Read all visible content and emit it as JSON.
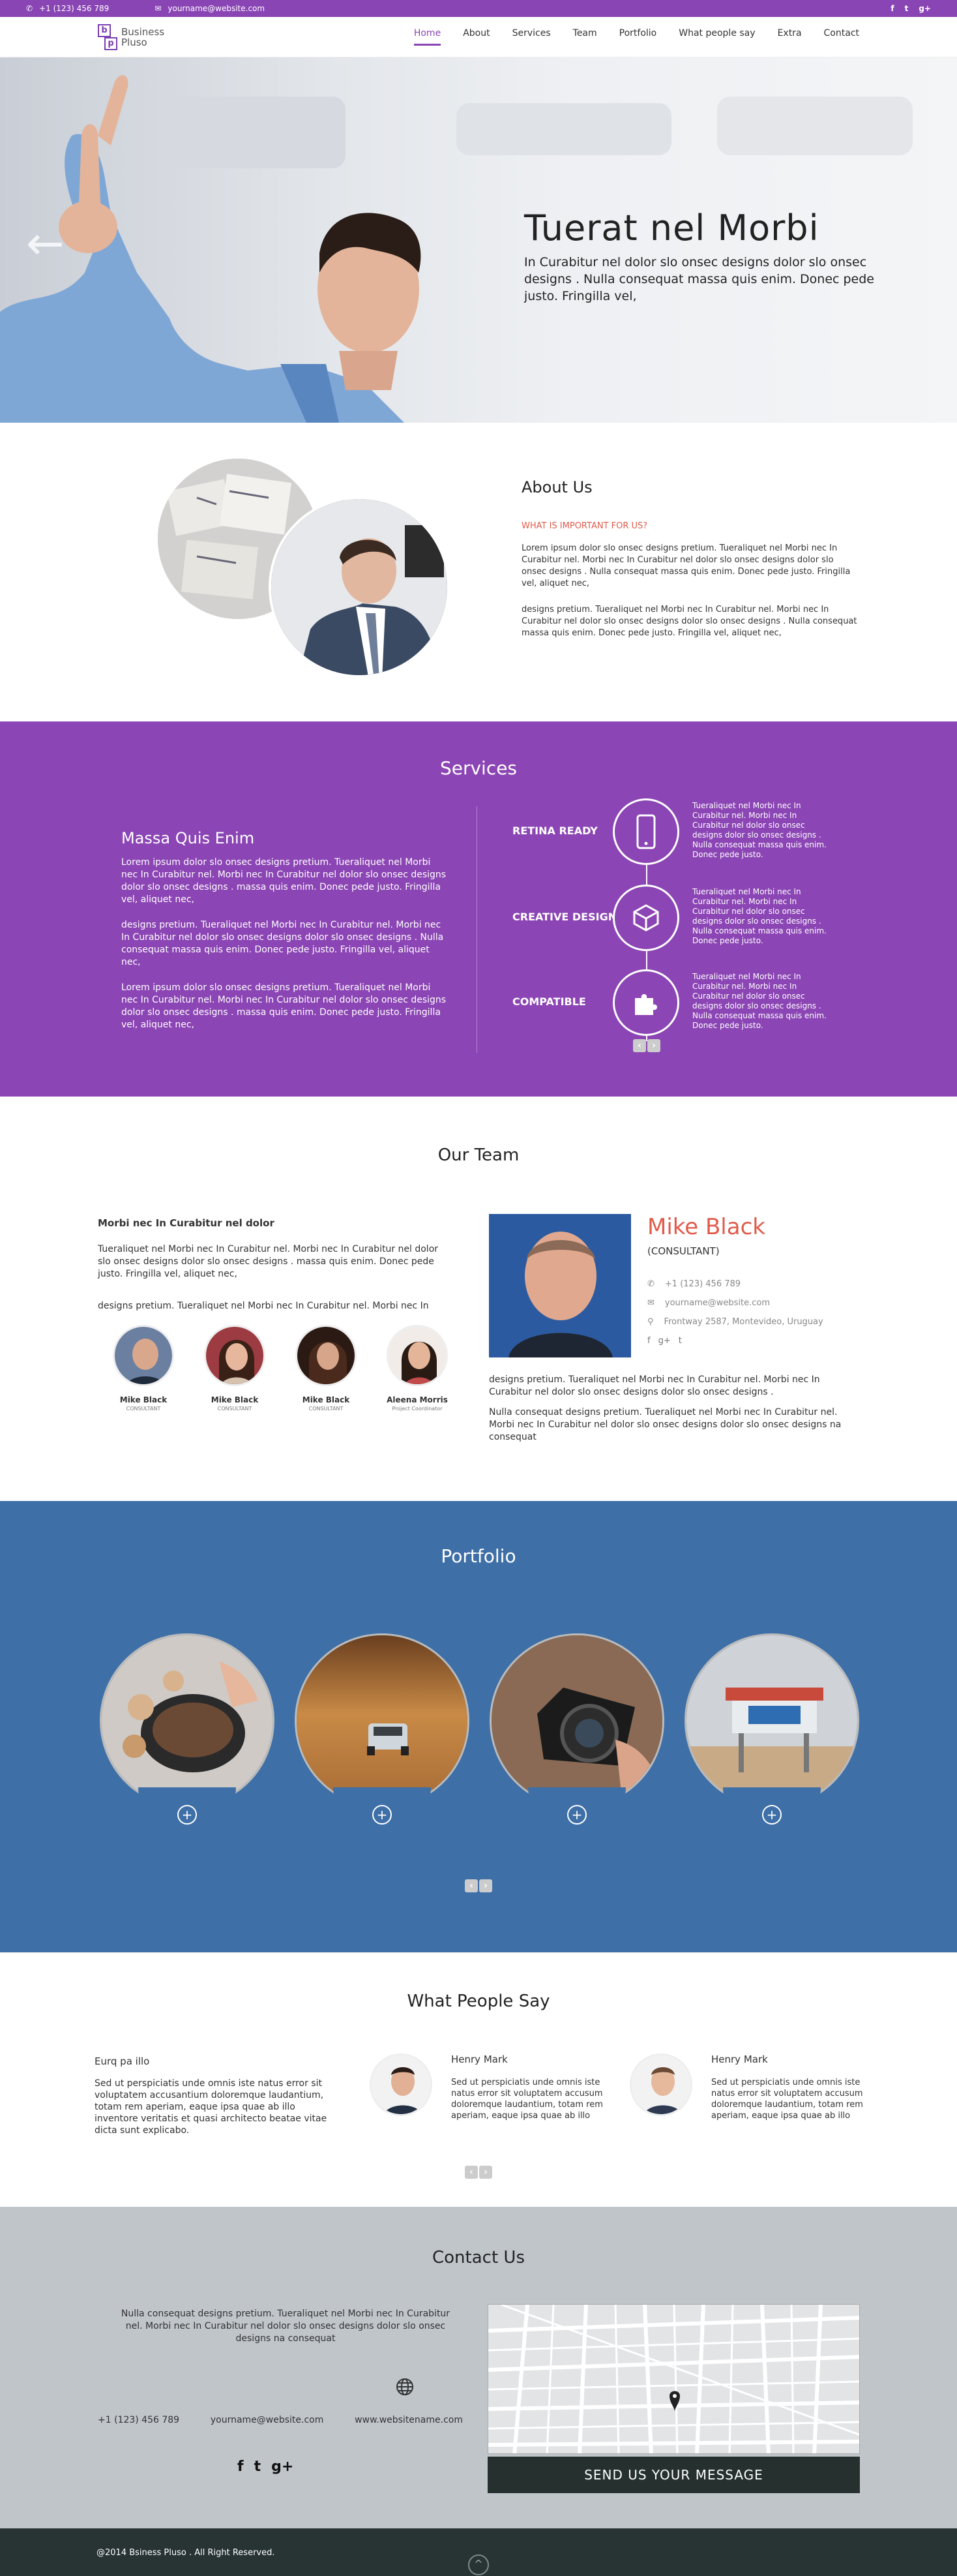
{
  "topbar": {
    "phone": "+1 (123) 456 789",
    "email": "yourname@website.com",
    "social": [
      "f",
      "t",
      "g+"
    ]
  },
  "logo": {
    "b": "b",
    "p": "p",
    "line1": "Business",
    "line2": "Pluso"
  },
  "nav": [
    "Home",
    "About",
    "Services",
    "Team",
    "Portfolio",
    "What people say",
    "Extra",
    "Contact"
  ],
  "hero": {
    "title": "Tuerat nel Morbi",
    "text": "In Curabitur nel dolor slo onsec designs dolor slo onsec designs . Nulla consequat massa quis enim. Donec pede justo. Fringilla vel,",
    "arrow": "←"
  },
  "about": {
    "title": "About Us",
    "subtitle": "WHAT IS IMPORTANT FOR US?",
    "p1": "Lorem ipsum dolor slo onsec designs pretium. Tueraliquet nel Morbi nec In Curabitur nel. Morbi nec In Curabitur nel dolor slo onsec designs dolor slo onsec designs . Nulla consequat massa quis enim. Donec pede justo. Fringilla vel, aliquet nec,",
    "p2": "designs pretium. Tueraliquet nel Morbi nec In Curabitur nel. Morbi nec In Curabitur nel dolor slo onsec designs dolor slo onsec designs . Nulla consequat massa quis enim. Donec pede justo. Fringilla vel, aliquet nec,"
  },
  "services": {
    "title": "Services",
    "left_title": "Massa Quis Enim",
    "left_p1": "Lorem ipsum dolor slo onsec designs pretium. Tueraliquet nel Morbi nec In Curabitur nel. Morbi nec In Curabitur nel dolor slo onsec designs dolor slo onsec designs .    massa quis enim. Donec pede justo. Fringilla vel, aliquet nec,",
    "left_p2": "designs pretium. Tueraliquet nel Morbi nec In Curabitur nel. Morbi nec In Curabitur nel dolor slo onsec designs dolor slo onsec designs . Nulla consequat massa quis enim. Donec pede justo. Fringilla vel, aliquet nec,",
    "left_p3": "Lorem ipsum dolor slo onsec designs pretium. Tueraliquet nel Morbi nec In Curabitur nel. Morbi nec In Curabitur nel dolor slo onsec designs dolor slo onsec designs .    massa quis enim. Donec pede justo. Fringilla vel, aliquet nec,",
    "items": [
      {
        "label": "RETINA READY",
        "icon": "phone-icon",
        "glyph": "▯",
        "desc": "Tueraliquet nel Morbi nec In Curabitur nel. Morbi nec In Curabitur nel dolor slo onsec designs dolor slo onsec designs . Nulla consequat massa quis enim. Donec pede justo."
      },
      {
        "label": "CREATIVE DESIGN",
        "icon": "cube-icon",
        "glyph": "⬡",
        "desc": "Tueraliquet nel Morbi nec In Curabitur nel. Morbi nec In Curabitur nel dolor slo onsec designs dolor slo onsec designs . Nulla consequat massa quis enim. Donec pede justo."
      },
      {
        "label": "COMPATIBLE",
        "icon": "puzzle-icon",
        "glyph": "✚",
        "desc": "Tueraliquet nel Morbi nec In Curabitur nel. Morbi nec In Curabitur nel dolor slo onsec designs dolor slo onsec designs . Nulla consequat massa quis enim. Donec pede justo."
      }
    ],
    "prev": "‹",
    "next": "›"
  },
  "team": {
    "title": "Our Team",
    "left_title": "Morbi nec In Curabitur nel dolor",
    "left_p1": "Tueraliquet nel Morbi nec In Curabitur nel. Morbi nec In Curabitur nel dolor slo onsec designs dolor slo onsec designs .    massa quis enim. Donec pede justo. Fringilla vel, aliquet nec,",
    "left_p2": "designs pretium. Tueraliquet nel Morbi nec In Curabitur nel. Morbi nec In",
    "members": [
      {
        "name": "Mike Black",
        "role": "CONSULTANT"
      },
      {
        "name": "Mike Black",
        "role": "CONSULTANT"
      },
      {
        "name": "Mike Black",
        "role": "CONSULTANT"
      },
      {
        "name": "Aleena Morris",
        "role": "Project Coordinator"
      }
    ],
    "profile": {
      "name": "Mike Black",
      "role": "(CONSULTANT)",
      "phone": "+1 (123) 456 789",
      "email": "yourname@website.com",
      "address": "Frontway 2587, Montevideo, Uruguay",
      "social": [
        "f",
        "g+",
        "t"
      ]
    },
    "bottom_p1": "designs pretium. Tueraliquet nel Morbi nec In Curabitur nel. Morbi nec In Curabitur nel dolor slo onsec designs dolor slo onsec designs .",
    "bottom_p2": "Nulla consequat designs pretium. Tueraliquet nel Morbi nec In Curabitur nel. Morbi nec In Curabitur nel dolor slo onsec designs dolor slo onsec designs na consequat"
  },
  "portfolio": {
    "title": "Portfolio",
    "plus": "+",
    "prev": "‹",
    "next": "›"
  },
  "testimonials": {
    "title": "What People Say",
    "first_title": "Eurq pa illo",
    "first_text": "Sed ut perspiciatis unde omnis iste natus error sit voluptatem accusantium doloremque laudantium, totam rem aperiam, eaque ipsa quae ab illo inventore veritatis et quasi architecto beatae vitae dicta sunt explicabo.",
    "cards": [
      {
        "name": "Henry Mark",
        "text": "Sed ut perspiciatis unde omnis iste natus error sit voluptatem accusum doloremque laudantium, totam rem aperiam, eaque ipsa quae ab illo"
      },
      {
        "name": "Henry Mark",
        "text": "Sed ut perspiciatis unde omnis iste natus error sit voluptatem accusum doloremque laudantium, totam rem aperiam, eaque ipsa quae ab illo"
      }
    ],
    "prev": "‹",
    "next": "›"
  },
  "contact": {
    "title": "Contact Us",
    "text": "Nulla consequat designs pretium. Tueraliquet nel Morbi nec In Curabitur nel. Morbi nec In Curabitur nel dolor slo onsec designs dolor slo onsec designs na consequat",
    "phone": "+1 (123) 456 789",
    "email": "yourname@website.com",
    "website": "www.websitename.com",
    "social": [
      "f",
      "t",
      "g+"
    ],
    "send": "SEND US YOUR MESSAGE"
  },
  "footer": {
    "copyright": "@2014 Bsiness Pluso . All Right Reserved.",
    "up": "^"
  }
}
